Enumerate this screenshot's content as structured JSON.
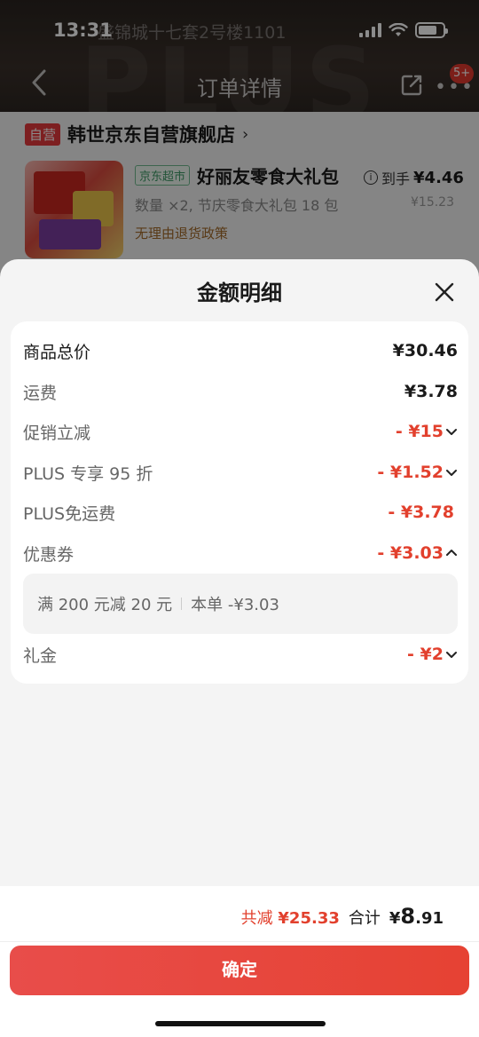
{
  "status_bar": {
    "time": "13:31"
  },
  "background_page": {
    "address_text": "盛锦城十七套2号楼1101",
    "watermark": "PLUS",
    "nav": {
      "title": "订单详情",
      "badge": "5+"
    },
    "shop": {
      "tag": "自营",
      "name": "韩世京东自营旗舰店",
      "chevron": "›"
    },
    "product": {
      "tag": "京东超市",
      "title": "好丽友零食大礼包",
      "meta": "数量 ×2, 节庆零食大礼包 18 包",
      "policy": "无理由退货政策",
      "price_label": "到手",
      "price_now": "¥4.46",
      "price_orig": "¥15.23"
    }
  },
  "sheet": {
    "title": "金额明细",
    "rows": [
      {
        "label": "商品总价",
        "value": "¥30.46"
      },
      {
        "label": "运费",
        "value": "¥3.78"
      },
      {
        "label": "促销立减",
        "value": "- ¥15"
      },
      {
        "label": "PLUS 专享 95 折",
        "value": "- ¥1.52"
      },
      {
        "label": "PLUS免运费",
        "value": "- ¥3.78"
      },
      {
        "label": "优惠券",
        "value": "- ¥3.03"
      },
      {
        "label": "礼金",
        "value": "- ¥2"
      }
    ],
    "coupon": {
      "condition": "满 200 元减 20 元",
      "this_order": "本单 -¥3.03"
    }
  },
  "footer": {
    "reduce_label": "共减",
    "reduce_value": "¥25.33",
    "total_label": "合计",
    "total_prefix": "¥",
    "total_int": "8",
    "total_dec": ".91",
    "confirm_label": "确定"
  },
  "colors": {
    "accent_red": "#e2402d",
    "button": "#e64233"
  }
}
